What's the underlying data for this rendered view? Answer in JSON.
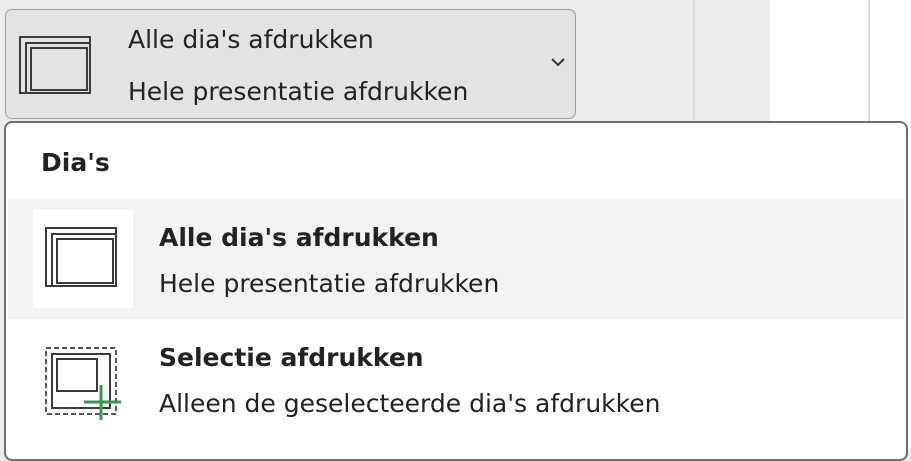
{
  "dropdown": {
    "title": "Alle dia's afdrukken",
    "subtitle": "Hele presentatie afdrukken",
    "icon": "all-slides-icon",
    "chevron_icon": "chevron-down-icon"
  },
  "menu": {
    "header": "Dia's",
    "items": [
      {
        "title": "Alle dia's afdrukken",
        "subtitle": "Hele presentatie afdrukken",
        "icon": "all-slides-icon",
        "selected": true
      },
      {
        "title": "Selectie afdrukken",
        "subtitle": "Alleen de geselecteerde dia's afdrukken",
        "icon": "selection-slides-icon",
        "selected": false
      }
    ]
  },
  "colors": {
    "icon_stroke": "#3a3a3a",
    "plus_accent": "#2e9e4f",
    "selected_row_bg": "#f3f3f3"
  }
}
